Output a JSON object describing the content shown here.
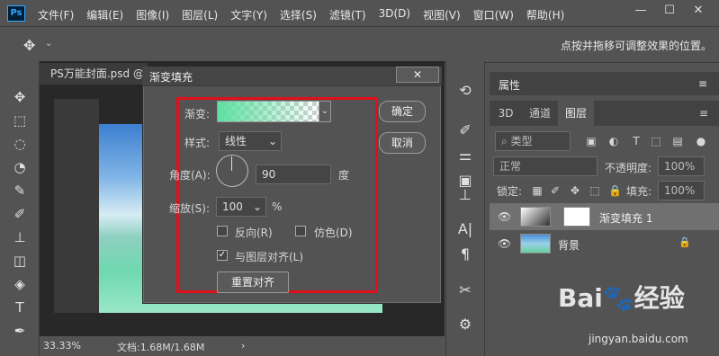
{
  "menubar": {
    "logo": "Ps",
    "items": [
      "文件(F)",
      "编辑(E)",
      "图像(I)",
      "图层(L)",
      "文字(Y)",
      "选择(S)",
      "滤镜(T)",
      "3D(D)",
      "视图(V)",
      "窗口(W)",
      "帮助(H)"
    ],
    "minimize": "—",
    "restore": "☐",
    "close": "✕"
  },
  "options": {
    "move_icon": "✥",
    "dropdown": "⌄",
    "hint": "点按并拖移可调整效果的位置。"
  },
  "document": {
    "tab_label": "PS万能封面.psd @",
    "zoom": "33.33%",
    "doc_info": "文档:1.68M/1.68M",
    "arrow": "›"
  },
  "dialog": {
    "title": "渐变填充",
    "close": "✕",
    "gradient_label": "渐变:",
    "style_label": "样式:",
    "style_value": "线性",
    "angle_label": "角度(A):",
    "angle_value": "90",
    "angle_unit": "度",
    "scale_label": "缩放(S):",
    "scale_value": "100",
    "scale_unit": "%",
    "reverse_label": "反向(R)",
    "dither_label": "仿色(D)",
    "align_label": "与图层对齐(L)",
    "align_checked": true,
    "reset_button": "重置对齐",
    "ok_button": "确定",
    "cancel_button": "取消"
  },
  "panel": {
    "properties_tab": "属性",
    "tabs": [
      "3D",
      "通道",
      "图层"
    ],
    "active_tab": "图层",
    "filter_label": "类型",
    "blend_mode": "正常",
    "opacity_label": "不透明度:",
    "opacity_value": "100%",
    "lock_label": "锁定:",
    "fill_label": "填充:",
    "fill_value": "100%",
    "layers": [
      {
        "name": "渐变填充 1",
        "selected": true
      },
      {
        "name": "背景",
        "selected": false
      }
    ],
    "menu_icon": "≡"
  },
  "watermark": {
    "text": "Bai🐾经验",
    "url": "jingyan.baidu.com"
  },
  "colors": {
    "gradient_start": "#5ee0a0",
    "highlight_red": "#e0101a",
    "ui_bg": "#535353"
  }
}
